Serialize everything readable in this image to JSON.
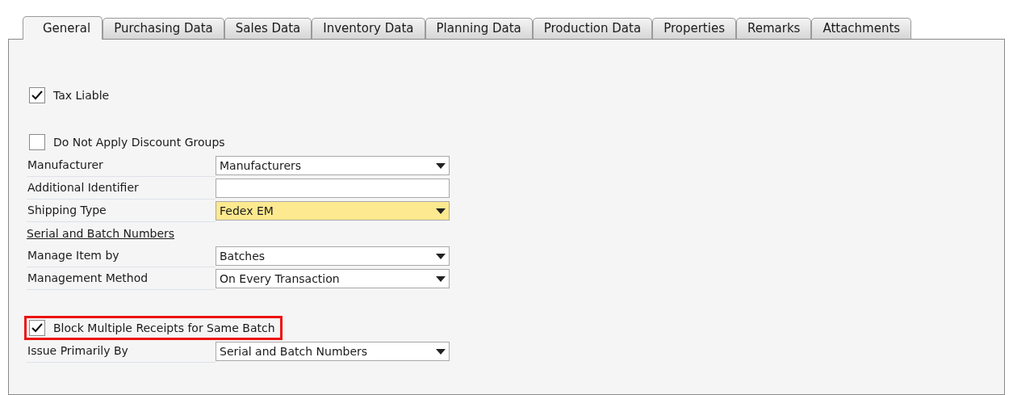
{
  "tabs": [
    {
      "label": "General",
      "selected": true
    },
    {
      "label": "Purchasing Data",
      "selected": false
    },
    {
      "label": "Sales Data",
      "selected": false
    },
    {
      "label": "Inventory Data",
      "selected": false
    },
    {
      "label": "Planning Data",
      "selected": false
    },
    {
      "label": "Production Data",
      "selected": false
    },
    {
      "label": "Properties",
      "selected": false
    },
    {
      "label": "Remarks",
      "selected": false
    },
    {
      "label": "Attachments",
      "selected": false
    }
  ],
  "form": [
    {
      "kind": "checkbox",
      "label": "Tax Liable",
      "checked": true,
      "highlighted": false
    },
    {
      "kind": "spacer"
    },
    {
      "kind": "checkbox",
      "label": "Do Not Apply Discount Groups",
      "checked": false,
      "highlighted": false
    },
    {
      "kind": "dropdown",
      "label": "Manufacturer",
      "value": "Manufacturers",
      "highlighted": false
    },
    {
      "kind": "text",
      "label": "Additional Identifier",
      "highlighted": false
    },
    {
      "kind": "dropdown",
      "label": "Shipping Type",
      "value": "Fedex EM",
      "highlighted": true
    },
    {
      "kind": "heading",
      "label": "Serial and Batch Numbers"
    },
    {
      "kind": "dropdown",
      "label": "Manage Item by",
      "value": "Batches",
      "highlighted": false
    },
    {
      "kind": "dropdown",
      "label": "Management Method",
      "value": "On Every Transaction",
      "highlighted": false
    },
    {
      "kind": "spacer"
    },
    {
      "kind": "checkbox",
      "label": "Block Multiple Receipts for Same Batch",
      "checked": true,
      "highlighted": true
    },
    {
      "kind": "dropdown",
      "label": "Issue Primarily By",
      "value": "Serial and Batch Numbers",
      "highlighted": false
    }
  ]
}
